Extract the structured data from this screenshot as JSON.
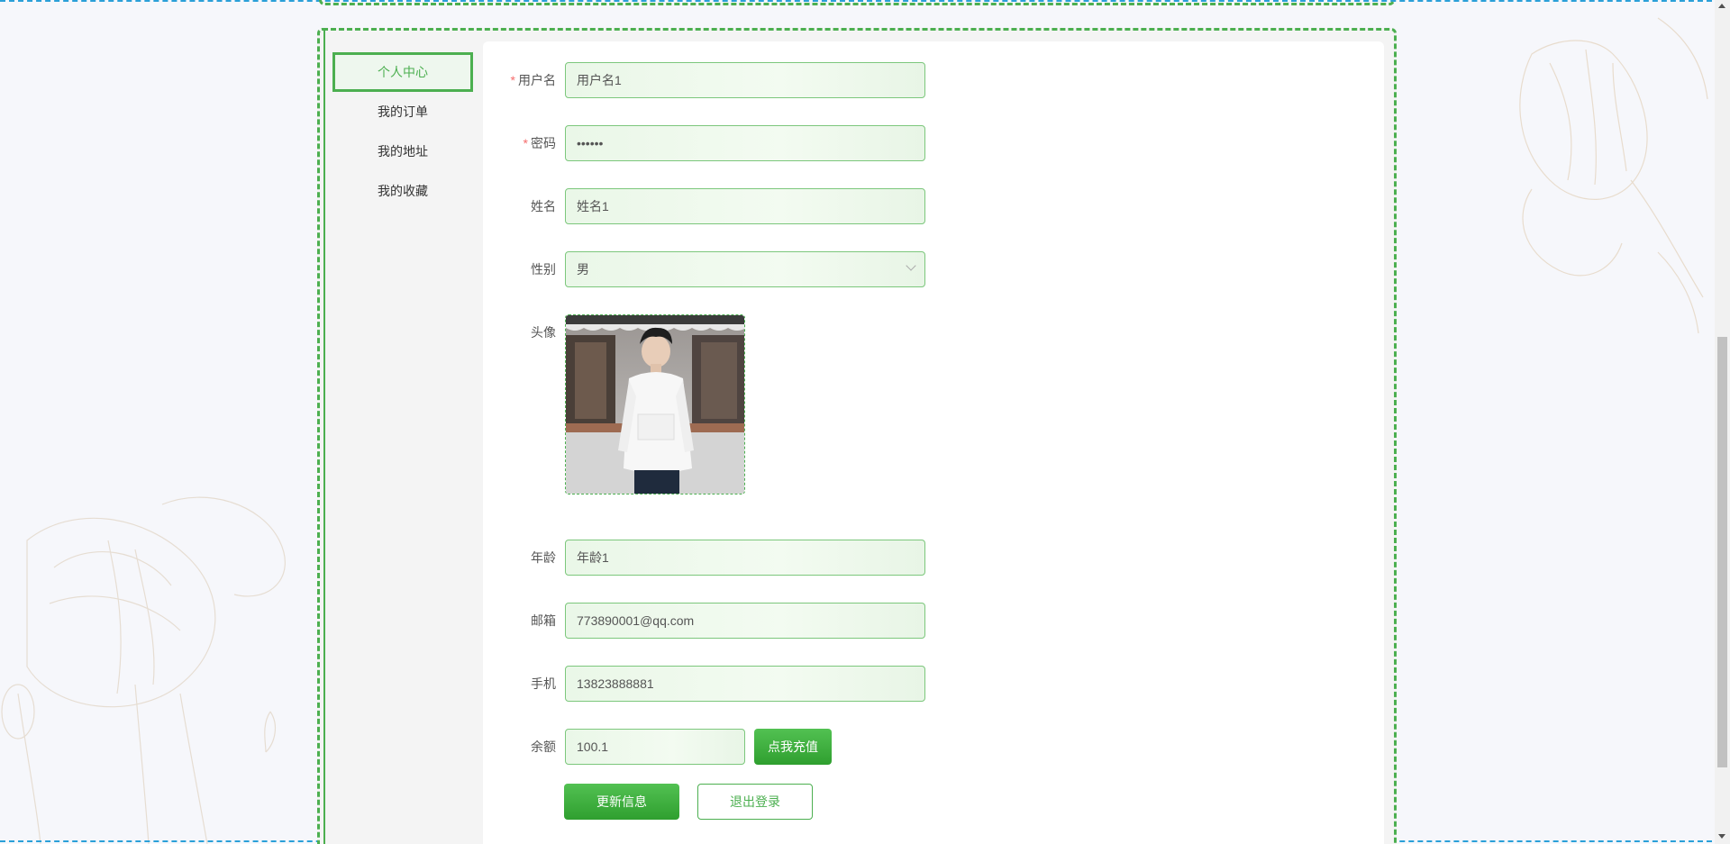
{
  "menu": {
    "items": [
      {
        "label": "个人中心",
        "active": true
      },
      {
        "label": "我的订单",
        "active": false
      },
      {
        "label": "我的地址",
        "active": false
      },
      {
        "label": "我的收藏",
        "active": false
      }
    ]
  },
  "form": {
    "username": {
      "label": "用户名",
      "value": "用户名1",
      "required": true
    },
    "password": {
      "label": "密码",
      "value": "••••••",
      "required": true
    },
    "name": {
      "label": "姓名",
      "value": "姓名1"
    },
    "gender": {
      "label": "性别",
      "value": "男"
    },
    "avatar": {
      "label": "头像"
    },
    "age": {
      "label": "年龄",
      "value": "年龄1"
    },
    "email": {
      "label": "邮箱",
      "value": "773890001@qq.com"
    },
    "phone": {
      "label": "手机",
      "value": "13823888881"
    },
    "balance": {
      "label": "余额",
      "value": "100.1",
      "recharge_label": "点我充值"
    },
    "required_mark": "*"
  },
  "actions": {
    "update_label": "更新信息",
    "logout_label": "退出登录"
  },
  "colors": {
    "accent": "#4caf50",
    "required": "#f56c6c",
    "edge": "#2aa0d8"
  }
}
